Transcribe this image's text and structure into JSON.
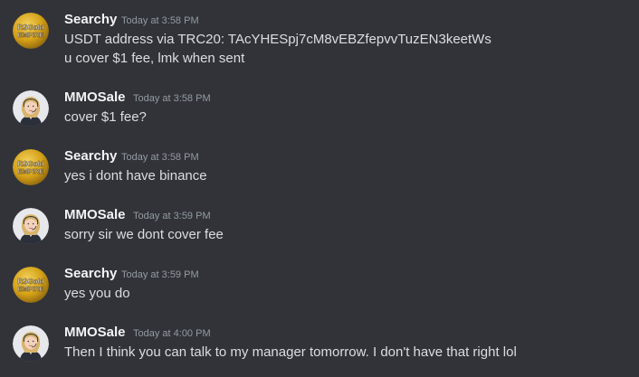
{
  "users": {
    "searchy": {
      "name": "Searchy",
      "avatar_icon": "rsgold-empire-logo-icon",
      "avatar_text_1": "RSGold",
      "avatar_text_2": "EMPIRE"
    },
    "mmosale": {
      "name": "MMOSale",
      "avatar_icon": "support-agent-avatar-icon"
    }
  },
  "messages": [
    {
      "user": "Searchy",
      "time": "Today at 3:58 PM",
      "lines": [
        "USDT address via TRC20: TAcYHESpj7cM8vEBZfepvvTuzEN3keetWs",
        "u cover $1 fee, lmk when sent"
      ]
    },
    {
      "user": "MMOSale",
      "time": "Today at 3:58 PM",
      "lines": [
        "cover $1 fee?"
      ]
    },
    {
      "user": "Searchy",
      "time": "Today at 3:58 PM",
      "lines": [
        "yes i dont have binance"
      ]
    },
    {
      "user": "MMOSale",
      "time": "Today at 3:59 PM",
      "lines": [
        "sorry sir we dont cover fee"
      ]
    },
    {
      "user": "Searchy",
      "time": "Today at 3:59 PM",
      "lines": [
        "yes you do"
      ]
    },
    {
      "user": "MMOSale",
      "time": "Today at 4:00 PM",
      "lines": [
        "Then I think you can talk to my manager tomorrow. I don't have that right lol"
      ]
    }
  ],
  "colors": {
    "background": "#313338",
    "username": "#f2f3f5",
    "timestamp": "#949ba4",
    "message_text": "#dbdee1",
    "gold": "#d4a017"
  }
}
